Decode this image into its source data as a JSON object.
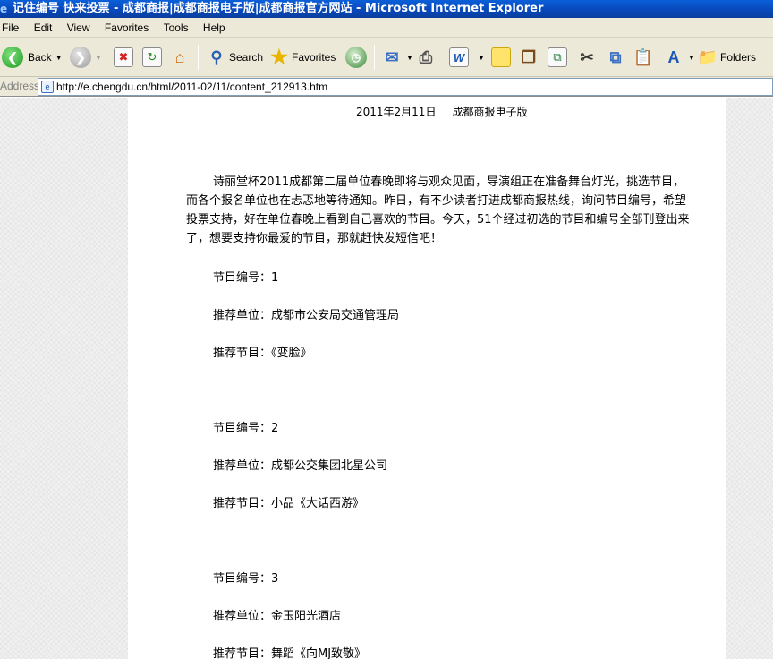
{
  "window": {
    "title": "记住编号 快来投票 - 成都商报|成都商报电子版|成都商报官方网站 - Microsoft Internet Explorer"
  },
  "menu": [
    "File",
    "Edit",
    "View",
    "Favorites",
    "Tools",
    "Help"
  ],
  "toolbar": {
    "back_label": "Back",
    "search_label": "Search",
    "favorites_label": "Favorites",
    "folders_label": "Folders"
  },
  "address": {
    "label": "Address",
    "url": "http://e.chengdu.cn/html/2011-02/11/content_212913.htm"
  },
  "article": {
    "date": "2011年2月11日",
    "edition": "成都商报电子版",
    "intro": "诗丽堂杯2011成都第二届单位春晚即将与观众见面，导演组正在准备舞台灯光，挑选节目，而各个报名单位也在忐忑地等待通知。昨日，有不少读者打进成都商报热线，询问节目编号，希望投票支持，好在单位春晚上看到自己喜欢的节目。今天，51个经过初选的节目和编号全部刊登出来了，想要支持你最爱的节目，那就赶快发短信吧！",
    "entries": [
      {
        "number": "节目编号：1",
        "unit": "推荐单位：成都市公安局交通管理局",
        "program": "推荐节目：《变脸》"
      },
      {
        "number": "节目编号：2",
        "unit": "推荐单位：成都公交集团北星公司",
        "program": "推荐节目：小品《大话西游》"
      },
      {
        "number": "节目编号：3",
        "unit": "推荐单位：金玉阳光酒店",
        "program": "推荐节目：舞蹈《向MJ致敬》"
      }
    ]
  }
}
